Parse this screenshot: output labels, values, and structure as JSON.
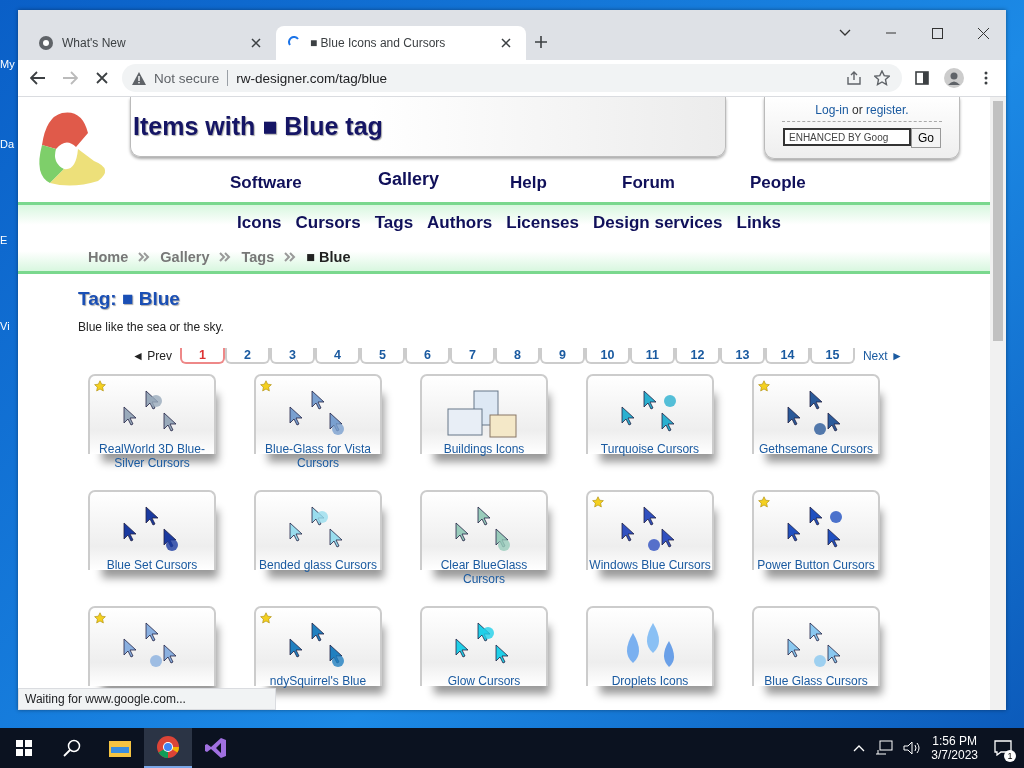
{
  "desktop": {
    "icons": [
      {
        "label": "My"
      },
      {
        "label": "Da"
      },
      {
        "label": "E"
      },
      {
        "label": "Vi"
      }
    ]
  },
  "browser": {
    "tabs": [
      {
        "title": "What's New",
        "selected": false,
        "loading": false
      },
      {
        "title": "■ Blue Icons and Cursors",
        "selected": true,
        "loading": true
      }
    ],
    "security": "Not secure",
    "url": "rw-designer.com/tag/blue",
    "status": "Waiting for www.google.com..."
  },
  "header": {
    "title": "Items with ■ Blue tag",
    "login": "Log-in",
    "or": "or",
    "register": "register.",
    "search_placeholder": "ENHANCED BY Goog",
    "go": "Go"
  },
  "main_nav": [
    {
      "label": "Software",
      "selected": false
    },
    {
      "label": "Gallery",
      "selected": true
    },
    {
      "label": "Help",
      "selected": false
    },
    {
      "label": "Forum",
      "selected": false
    },
    {
      "label": "People",
      "selected": false
    }
  ],
  "sub_nav": [
    "Icons",
    "Cursors",
    "Tags",
    "Authors",
    "Licenses",
    "Design services",
    "Links"
  ],
  "breadcrumb": [
    "Home",
    "Gallery",
    "Tags",
    "■ Blue"
  ],
  "tag": {
    "heading": "Tag: ■ Blue",
    "description": "Blue like the sea or the sky."
  },
  "pagination": {
    "prev": "◄ Prev",
    "next": "Next ►",
    "pages": [
      {
        "label": "1",
        "selected": true
      },
      {
        "label": "2",
        "selected": false
      },
      {
        "label": "3",
        "selected": false
      },
      {
        "label": "4",
        "selected": false
      },
      {
        "label": "5",
        "selected": false
      },
      {
        "label": "6",
        "selected": false
      },
      {
        "label": "7",
        "selected": false
      },
      {
        "label": "8",
        "selected": false
      },
      {
        "label": "9",
        "selected": false
      },
      {
        "label": "10",
        "selected": false
      },
      {
        "label": "11",
        "selected": false
      },
      {
        "label": "12",
        "selected": false
      },
      {
        "label": "13",
        "selected": false
      },
      {
        "label": "14",
        "selected": false
      },
      {
        "label": "15",
        "selected": false
      }
    ]
  },
  "items": [
    {
      "name": "RealWorld 3D Blue-Silver Cursors",
      "starred": true
    },
    {
      "name": "Blue-Glass for Vista Cursors",
      "starred": true
    },
    {
      "name": "Buildings Icons",
      "starred": false
    },
    {
      "name": "Turquoise Cursors",
      "starred": false
    },
    {
      "name": "Gethsemane Cursors",
      "starred": true
    },
    {
      "name": "Blue Set Cursors",
      "starred": false
    },
    {
      "name": "Bended glass Cursors",
      "starred": false
    },
    {
      "name": "Clear BlueGlass Cursors",
      "starred": false
    },
    {
      "name": "Windows Blue Cursors",
      "starred": true
    },
    {
      "name": "Power Button Cursors",
      "starred": true
    },
    {
      "starred": true
    },
    {
      "name": "ndySquirrel's Blue",
      "starred": true
    },
    {
      "name": "Glow Cursors",
      "starred": false
    },
    {
      "name": "Droplets Icons",
      "starred": false
    },
    {
      "name": "Blue Glass Cursors",
      "starred": false
    }
  ],
  "taskbar": {
    "time": "1:56 PM",
    "date": "3/7/2023",
    "notifications": "1"
  }
}
